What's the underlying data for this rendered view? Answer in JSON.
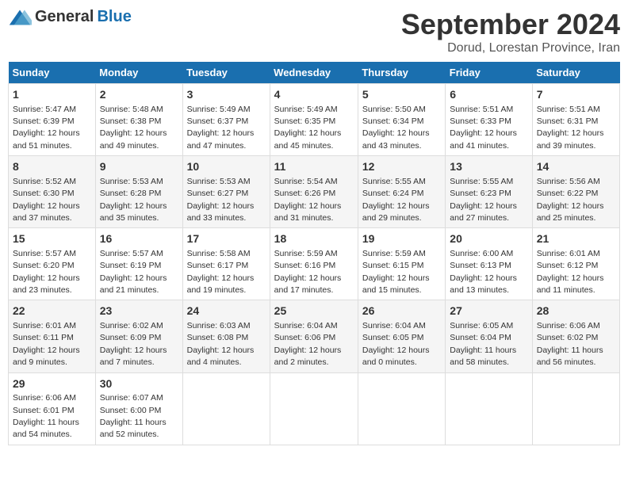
{
  "header": {
    "logo_general": "General",
    "logo_blue": "Blue",
    "month": "September 2024",
    "location": "Dorud, Lorestan Province, Iran"
  },
  "weekdays": [
    "Sunday",
    "Monday",
    "Tuesday",
    "Wednesday",
    "Thursday",
    "Friday",
    "Saturday"
  ],
  "weeks": [
    [
      {
        "day": "1",
        "info": "Sunrise: 5:47 AM\nSunset: 6:39 PM\nDaylight: 12 hours\nand 51 minutes."
      },
      {
        "day": "2",
        "info": "Sunrise: 5:48 AM\nSunset: 6:38 PM\nDaylight: 12 hours\nand 49 minutes."
      },
      {
        "day": "3",
        "info": "Sunrise: 5:49 AM\nSunset: 6:37 PM\nDaylight: 12 hours\nand 47 minutes."
      },
      {
        "day": "4",
        "info": "Sunrise: 5:49 AM\nSunset: 6:35 PM\nDaylight: 12 hours\nand 45 minutes."
      },
      {
        "day": "5",
        "info": "Sunrise: 5:50 AM\nSunset: 6:34 PM\nDaylight: 12 hours\nand 43 minutes."
      },
      {
        "day": "6",
        "info": "Sunrise: 5:51 AM\nSunset: 6:33 PM\nDaylight: 12 hours\nand 41 minutes."
      },
      {
        "day": "7",
        "info": "Sunrise: 5:51 AM\nSunset: 6:31 PM\nDaylight: 12 hours\nand 39 minutes."
      }
    ],
    [
      {
        "day": "8",
        "info": "Sunrise: 5:52 AM\nSunset: 6:30 PM\nDaylight: 12 hours\nand 37 minutes."
      },
      {
        "day": "9",
        "info": "Sunrise: 5:53 AM\nSunset: 6:28 PM\nDaylight: 12 hours\nand 35 minutes."
      },
      {
        "day": "10",
        "info": "Sunrise: 5:53 AM\nSunset: 6:27 PM\nDaylight: 12 hours\nand 33 minutes."
      },
      {
        "day": "11",
        "info": "Sunrise: 5:54 AM\nSunset: 6:26 PM\nDaylight: 12 hours\nand 31 minutes."
      },
      {
        "day": "12",
        "info": "Sunrise: 5:55 AM\nSunset: 6:24 PM\nDaylight: 12 hours\nand 29 minutes."
      },
      {
        "day": "13",
        "info": "Sunrise: 5:55 AM\nSunset: 6:23 PM\nDaylight: 12 hours\nand 27 minutes."
      },
      {
        "day": "14",
        "info": "Sunrise: 5:56 AM\nSunset: 6:22 PM\nDaylight: 12 hours\nand 25 minutes."
      }
    ],
    [
      {
        "day": "15",
        "info": "Sunrise: 5:57 AM\nSunset: 6:20 PM\nDaylight: 12 hours\nand 23 minutes."
      },
      {
        "day": "16",
        "info": "Sunrise: 5:57 AM\nSunset: 6:19 PM\nDaylight: 12 hours\nand 21 minutes."
      },
      {
        "day": "17",
        "info": "Sunrise: 5:58 AM\nSunset: 6:17 PM\nDaylight: 12 hours\nand 19 minutes."
      },
      {
        "day": "18",
        "info": "Sunrise: 5:59 AM\nSunset: 6:16 PM\nDaylight: 12 hours\nand 17 minutes."
      },
      {
        "day": "19",
        "info": "Sunrise: 5:59 AM\nSunset: 6:15 PM\nDaylight: 12 hours\nand 15 minutes."
      },
      {
        "day": "20",
        "info": "Sunrise: 6:00 AM\nSunset: 6:13 PM\nDaylight: 12 hours\nand 13 minutes."
      },
      {
        "day": "21",
        "info": "Sunrise: 6:01 AM\nSunset: 6:12 PM\nDaylight: 12 hours\nand 11 minutes."
      }
    ],
    [
      {
        "day": "22",
        "info": "Sunrise: 6:01 AM\nSunset: 6:11 PM\nDaylight: 12 hours\nand 9 minutes."
      },
      {
        "day": "23",
        "info": "Sunrise: 6:02 AM\nSunset: 6:09 PM\nDaylight: 12 hours\nand 7 minutes."
      },
      {
        "day": "24",
        "info": "Sunrise: 6:03 AM\nSunset: 6:08 PM\nDaylight: 12 hours\nand 4 minutes."
      },
      {
        "day": "25",
        "info": "Sunrise: 6:04 AM\nSunset: 6:06 PM\nDaylight: 12 hours\nand 2 minutes."
      },
      {
        "day": "26",
        "info": "Sunrise: 6:04 AM\nSunset: 6:05 PM\nDaylight: 12 hours\nand 0 minutes."
      },
      {
        "day": "27",
        "info": "Sunrise: 6:05 AM\nSunset: 6:04 PM\nDaylight: 11 hours\nand 58 minutes."
      },
      {
        "day": "28",
        "info": "Sunrise: 6:06 AM\nSunset: 6:02 PM\nDaylight: 11 hours\nand 56 minutes."
      }
    ],
    [
      {
        "day": "29",
        "info": "Sunrise: 6:06 AM\nSunset: 6:01 PM\nDaylight: 11 hours\nand 54 minutes."
      },
      {
        "day": "30",
        "info": "Sunrise: 6:07 AM\nSunset: 6:00 PM\nDaylight: 11 hours\nand 52 minutes."
      },
      {
        "day": "",
        "info": ""
      },
      {
        "day": "",
        "info": ""
      },
      {
        "day": "",
        "info": ""
      },
      {
        "day": "",
        "info": ""
      },
      {
        "day": "",
        "info": ""
      }
    ]
  ]
}
